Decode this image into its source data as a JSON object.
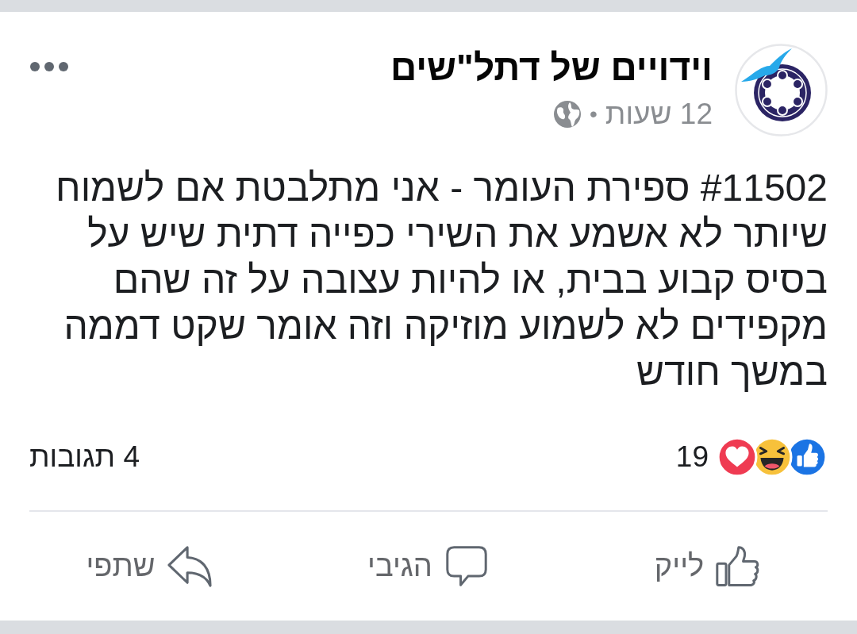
{
  "post": {
    "page_name": "וידויים של דתל\"שים",
    "time": "12 שעות",
    "separator": "•",
    "text": "#11502 ספירת העומר - אני מתלבטת אם לשמוח שיותר לא אשמע את השירי כפייה דתית שיש על בסיס קבוע בבית, או להיות עצובה על זה שהם מקפידים לא לשמוע מוזיקה וזה אומר שקט דממה במשך חודש",
    "reactions": [
      {
        "kind": "like"
      },
      {
        "kind": "haha"
      },
      {
        "kind": "love"
      }
    ],
    "reaction_count": "19",
    "comments": "4 תגובות"
  },
  "actions": [
    {
      "kind": "like",
      "label": "לייק"
    },
    {
      "kind": "comment",
      "label": "הגיבי"
    },
    {
      "kind": "share",
      "label": "שתפי"
    }
  ]
}
